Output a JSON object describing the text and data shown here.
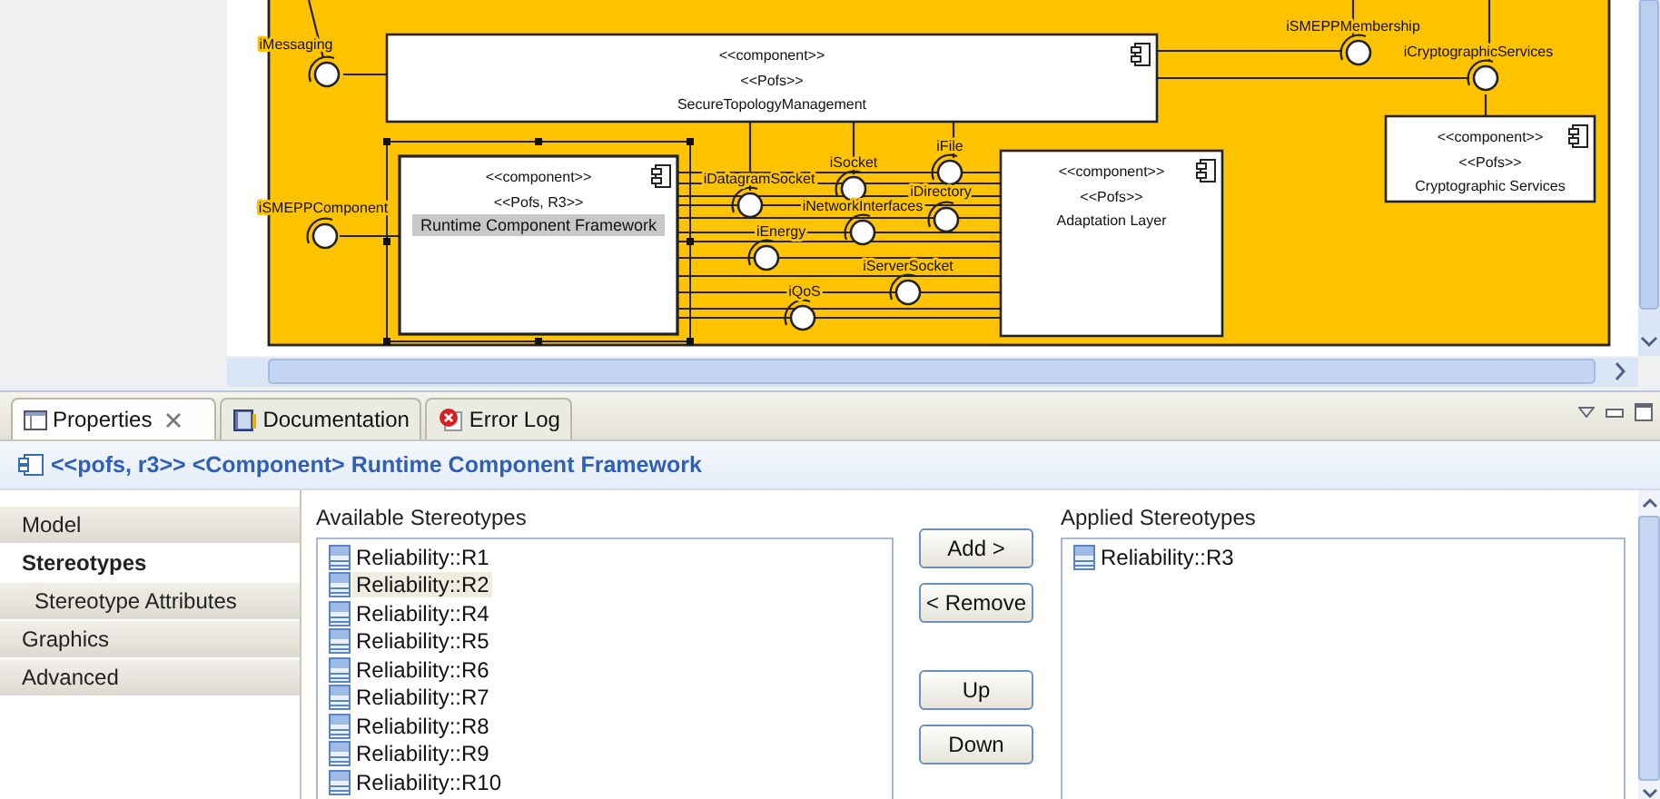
{
  "diagram": {
    "components": [
      {
        "stereotypes": [
          "<<component>>",
          "<<Pofs>>"
        ],
        "name": "SecureTopologyManagement",
        "selected": false
      },
      {
        "stereotypes": [
          "<<component>>",
          "<<Pofs>>"
        ],
        "name": "Cryptographic Services",
        "selected": false
      },
      {
        "stereotypes": [
          "<<component>>",
          "<<Pofs, R3>>"
        ],
        "name": "Runtime Component Framework",
        "selected": true
      },
      {
        "stereotypes": [
          "<<component>>",
          "<<Pofs>>"
        ],
        "name": "Adaptation Layer",
        "selected": false
      }
    ],
    "interfaces": [
      {
        "label": "iSMEPPMembership"
      },
      {
        "label": "iMessaging"
      },
      {
        "label": "iCryptographicServices"
      },
      {
        "label": "iFile"
      },
      {
        "label": "iSocket"
      },
      {
        "label": "iDatagramSocket"
      },
      {
        "label": "iDirectory"
      },
      {
        "label": "iSMEPPComponent"
      },
      {
        "label": "iNetworkInterfaces"
      },
      {
        "label": "iEnergy"
      },
      {
        "label": "iServerSocket"
      },
      {
        "label": "iQoS"
      }
    ]
  },
  "panel": {
    "tabs": [
      {
        "label": "Properties",
        "selected": true,
        "closable": true
      },
      {
        "label": "Documentation",
        "selected": false,
        "closable": false
      },
      {
        "label": "Error Log",
        "selected": false,
        "closable": false
      }
    ],
    "title": "<<pofs, r3>> <Component> Runtime Component Framework",
    "sections": [
      {
        "label": "Model",
        "selected": false
      },
      {
        "label": "Stereotypes",
        "selected": true,
        "children": [
          {
            "label": "Stereotype Attributes",
            "selected": false
          }
        ]
      },
      {
        "label": "Graphics",
        "selected": false
      },
      {
        "label": "Advanced",
        "selected": false
      }
    ],
    "available": {
      "label": "Available Stereotypes",
      "items": [
        {
          "label": "Reliability::R1",
          "selected": false
        },
        {
          "label": "Reliability::R2",
          "selected": true
        },
        {
          "label": "Reliability::R4",
          "selected": false
        },
        {
          "label": "Reliability::R5",
          "selected": false
        },
        {
          "label": "Reliability::R6",
          "selected": false
        },
        {
          "label": "Reliability::R7",
          "selected": false
        },
        {
          "label": "Reliability::R8",
          "selected": false
        },
        {
          "label": "Reliability::R9",
          "selected": false
        },
        {
          "label": "Reliability::R10",
          "selected": false
        }
      ]
    },
    "buttons": [
      "Add >",
      "< Remove",
      "Up",
      "Down"
    ],
    "applied": {
      "label": "Applied Stereotypes",
      "items": [
        {
          "label": "Reliability::R3",
          "selected": false
        }
      ]
    }
  }
}
